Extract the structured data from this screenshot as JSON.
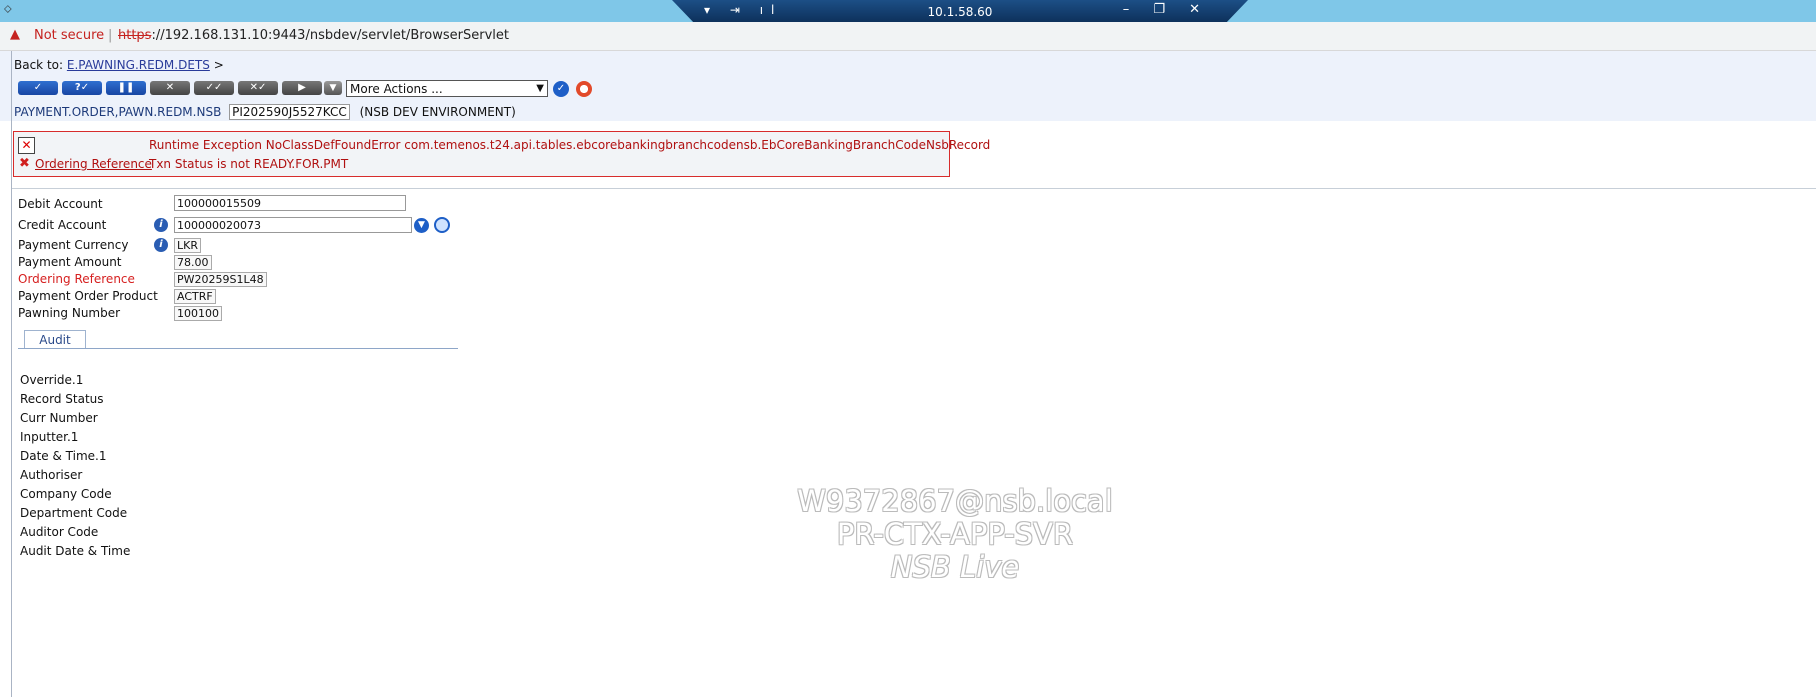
{
  "remote": {
    "ip": "10.1.58.60",
    "left_controls": "▾ ⇥ ıl",
    "right_controls": "– ❐ ✕"
  },
  "address": {
    "warning_icon": "warning-icon",
    "not_secure": "Not secure",
    "separator": "|",
    "url_protocol": "https",
    "url_rest": "://192.168.131.10:9443/nsbdev/servlet/BrowserServlet"
  },
  "header": {
    "back_to_label": "Back to:",
    "back_to_link": "E.PAWNING.REDM.DETS",
    "back_to_suffix": ">",
    "more_actions": "More Actions ...",
    "app_name": "PAYMENT.ORDER,PAWN.REDM.NSB",
    "txn_id": "PI202590J5527KCC",
    "environment": "(NSB DEV ENVIRONMENT)"
  },
  "toolbar": {
    "buttons": [
      {
        "icon": "commit-icon",
        "glyph": "✓"
      },
      {
        "icon": "validate-icon",
        "glyph": "?✓"
      },
      {
        "icon": "hold-icon",
        "glyph": "❚❚"
      },
      {
        "icon": "delete-icon",
        "glyph": "✕"
      },
      {
        "icon": "authorise-icon",
        "glyph": "✓✓"
      },
      {
        "icon": "reverse-icon",
        "glyph": "✕✓"
      },
      {
        "icon": "next-icon",
        "glyph": "▶"
      }
    ]
  },
  "error": {
    "message": "Runtime Exception NoClassDefFoundError com.temenos.t24.api.tables.ebcorebankingbranchcodensb.EbCoreBankingBranchCodeNsbRecord",
    "field_link": "Ordering Reference",
    "field_message": "Txn Status is not READY.FOR.PMT"
  },
  "form": {
    "debit_account_label": "Debit Account",
    "debit_account_value": "100000015509",
    "credit_account_label": "Credit Account",
    "credit_account_value": "100000020073",
    "payment_currency_label": "Payment Currency",
    "payment_currency_value": "LKR",
    "payment_amount_label": "Payment Amount",
    "payment_amount_value": "78.00",
    "ordering_reference_label": "Ordering Reference",
    "ordering_reference_value": "PW20259S1L48",
    "payment_order_product_label": "Payment Order Product",
    "payment_order_product_value": "ACTRF",
    "pawning_number_label": "Pawning Number",
    "pawning_number_value": "100100"
  },
  "tabs": {
    "audit": "Audit"
  },
  "audit_fields": [
    "Override.1",
    "Record Status",
    "Curr Number",
    "Inputter.1",
    "Date & Time.1",
    "Authoriser",
    "Company Code",
    "Department Code",
    "Auditor Code",
    "Audit Date & Time"
  ],
  "watermark": {
    "line1": "W9372867@nsb.local",
    "line2": "PR-CTX-APP-SVR",
    "line3": "NSB Live"
  }
}
